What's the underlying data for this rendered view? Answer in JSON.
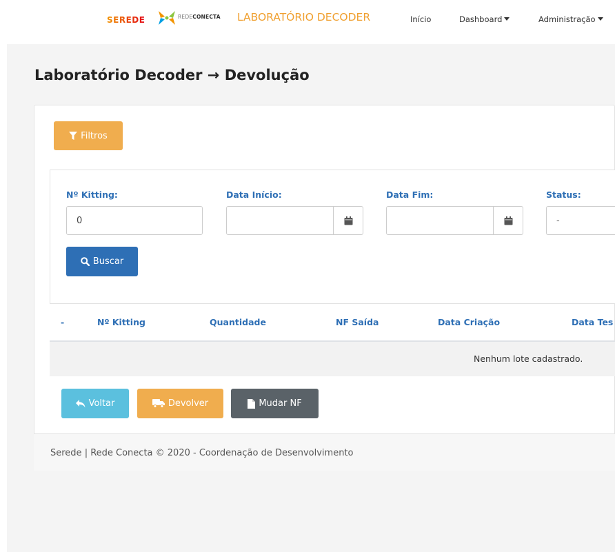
{
  "navbar": {
    "logo_serede": "SEREDE",
    "logo_conecta_prefix": "REDE",
    "logo_conecta_suffix": "CONECTA",
    "brand_title": "LABORATÓRIO DECODER",
    "links": [
      {
        "label": "Início"
      },
      {
        "label": "Dashboard"
      },
      {
        "label": "Administração"
      }
    ]
  },
  "page": {
    "title": "Laboratório Decoder → Devolução"
  },
  "filters": {
    "toggle_label": "Filtros",
    "kitting_label": "Nº Kitting:",
    "kitting_value": "0",
    "data_inicio_label": "Data Início:",
    "data_inicio_value": "",
    "data_fim_label": "Data Fim:",
    "data_fim_value": "",
    "status_label": "Status:",
    "status_value": "-",
    "search_label": "Buscar"
  },
  "table": {
    "columns": [
      "-",
      "Nº Kitting",
      "Quantidade",
      "NF Saída",
      "Data Criação",
      "Data Tes"
    ],
    "empty_message": "Nenhum lote cadastrado."
  },
  "actions": {
    "voltar": "Voltar",
    "devolver": "Devolver",
    "mudar_nf": "Mudar NF"
  },
  "footer": {
    "text": "Serede | Rede Conecta © 2020 - Coordenação de Desenvolvimento"
  },
  "colors": {
    "brand_orange": "#f0a030",
    "primary_blue": "#2e6fb5",
    "warning": "#f0ad4e",
    "info": "#5bc0de",
    "secondary": "#5a6268"
  }
}
